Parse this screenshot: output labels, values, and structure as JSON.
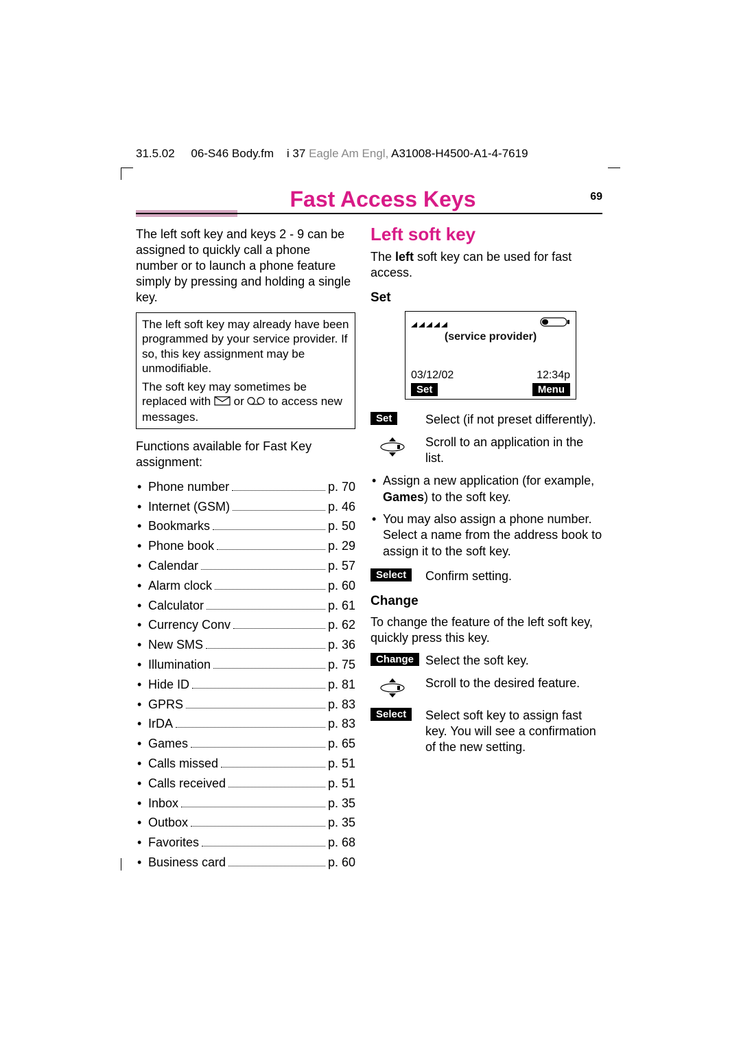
{
  "meta": {
    "date": "31.5.02",
    "file": "06-S46 Body.fm",
    "idx": "i 37",
    "grey": "Eagle  Am Engl,",
    "code": "A31008-H4500-A1-4-7619"
  },
  "title": "Fast Access Keys",
  "page_number": "69",
  "left": {
    "intro": "The left soft key and keys 2 - 9 can be assigned to quickly call a phone number or to launch a phone feature simply by pressing and holding a single key.",
    "note_line1": "The left soft key may already have been programmed by your service provider. If so, this key assignment may be unmodifiable.",
    "note_line2a": "The soft key may sometimes be replaced with ",
    "note_line2b": " or ",
    "note_line2c": " to access new messages.",
    "avail": "Functions available for Fast Key assignment:",
    "toc": [
      {
        "name": "Phone number",
        "page": "p. 70"
      },
      {
        "name": "Internet (GSM)",
        "page": "p. 46"
      },
      {
        "name": "Bookmarks",
        "page": "p. 50"
      },
      {
        "name": "Phone book",
        "page": "p. 29"
      },
      {
        "name": "Calendar",
        "page": "p. 57"
      },
      {
        "name": "Alarm clock",
        "page": "p. 60"
      },
      {
        "name": "Calculator",
        "page": "p. 61"
      },
      {
        "name": "Currency Conv",
        "page": "p. 62"
      },
      {
        "name": "New SMS",
        "page": "p. 36"
      },
      {
        "name": "Illumination",
        "page": "p. 75"
      },
      {
        "name": "Hide ID",
        "page": "p. 81"
      },
      {
        "name": "GPRS",
        "page": "p. 83"
      },
      {
        "name": "IrDA",
        "page": "p. 83"
      },
      {
        "name": "Games",
        "page": "p. 65"
      },
      {
        "name": "Calls missed",
        "page": "p. 51"
      },
      {
        "name": "Calls received",
        "page": "p. 51"
      },
      {
        "name": "Inbox",
        "page": "p. 35"
      },
      {
        "name": "Outbox",
        "page": "p. 35"
      },
      {
        "name": "Favorites",
        "page": "p. 68"
      },
      {
        "name": "Business card",
        "page": "p. 60"
      }
    ]
  },
  "right": {
    "h2": "Left soft key",
    "intro_a": "The ",
    "intro_bold": "left",
    "intro_b": " soft key can be used for fast access.",
    "set_h": "Set",
    "phone": {
      "provider": "(service provider)",
      "date": "03/12/02",
      "time": "12:34p",
      "sk_left": "Set",
      "sk_right": "Menu"
    },
    "set_step1_label": "Set",
    "set_step1_text": "Select (if not preset differently).",
    "set_step2_text": "Scroll to an application in the list.",
    "set_bullets": [
      {
        "pre": "Assign a new application (for example, ",
        "bold": "Games",
        "post": ") to the soft key."
      },
      {
        "pre": "You may also assign a phone number. Select a name from the address book to assign it to the soft key.",
        "bold": "",
        "post": ""
      }
    ],
    "set_confirm_label": "Select",
    "set_confirm_text": "Confirm setting.",
    "change_h": "Change",
    "change_intro": "To change the feature of the left soft key, quickly press this key.",
    "change_step1_label": "Change",
    "change_step1_text": "Select the soft key.",
    "change_step2_text": "Scroll to the desired feature.",
    "change_step3_label": "Select",
    "change_step3_text": "Select soft key to assign fast key. You will see a confirmation of the new setting."
  }
}
